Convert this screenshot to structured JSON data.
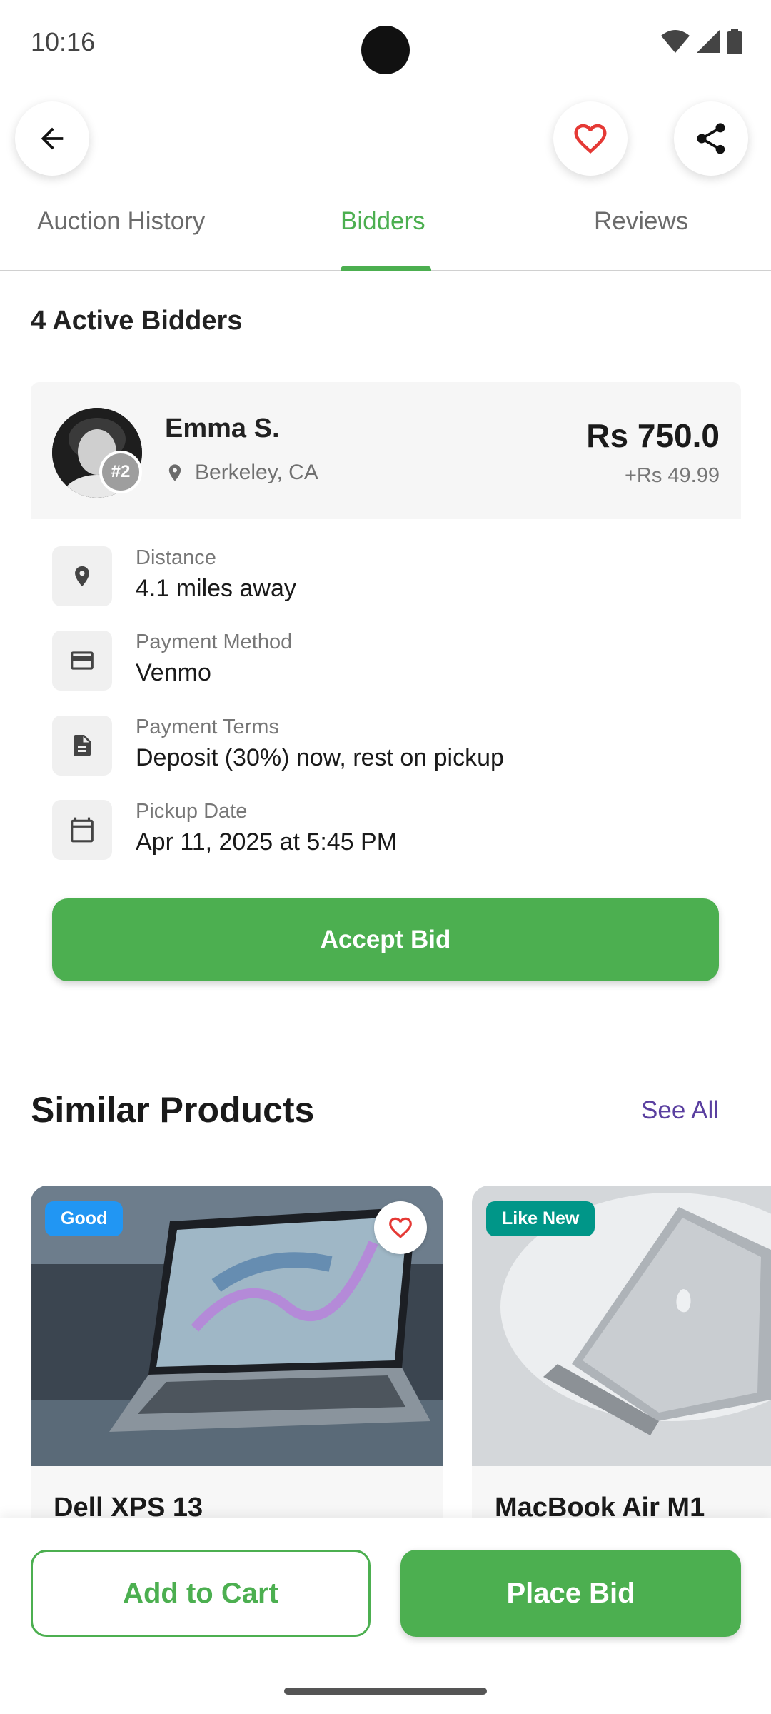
{
  "status_bar": {
    "time": "10:16",
    "icons": [
      "wifi-icon",
      "signal-icon",
      "battery-icon"
    ]
  },
  "header": {
    "back_icon": "arrow-back-icon",
    "favorite_icon": "heart-outline-icon",
    "share_icon": "share-icon"
  },
  "tabs": [
    {
      "label": "Auction History",
      "active": false
    },
    {
      "label": "Bidders",
      "active": true
    },
    {
      "label": "Reviews",
      "active": false
    }
  ],
  "bidders_section": {
    "title": "4 Active Bidders"
  },
  "bidder": {
    "name": "Emma S.",
    "rank": "#2",
    "location": "Berkeley, CA",
    "amount": "Rs 750.0",
    "fee": "+Rs 49.99",
    "details": [
      {
        "icon": "location-pin-icon",
        "label": "Distance",
        "value": "4.1 miles away"
      },
      {
        "icon": "credit-card-icon",
        "label": "Payment Method",
        "value": "Venmo"
      },
      {
        "icon": "document-icon",
        "label": "Payment Terms",
        "value": "Deposit (30%) now, rest on pickup"
      },
      {
        "icon": "calendar-icon",
        "label": "Pickup Date",
        "value": "Apr 11, 2025 at 5:45 PM"
      }
    ],
    "accept_label": "Accept Bid"
  },
  "similar": {
    "title": "Similar Products",
    "see_all": "See All",
    "products": [
      {
        "name": "Dell XPS 13",
        "condition": "Good",
        "condition_color": "#2196f3"
      },
      {
        "name": "MacBook Air M1",
        "condition": "Like New",
        "condition_color": "#009688"
      }
    ]
  },
  "bottom_actions": {
    "add_to_cart": "Add to Cart",
    "place_bid": "Place Bid"
  },
  "colors": {
    "accent": "#4caf50",
    "favorite": "#e53935",
    "link": "#5a3fa0"
  }
}
